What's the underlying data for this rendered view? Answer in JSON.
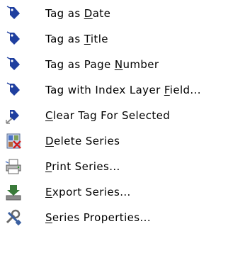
{
  "menu": {
    "items": [
      {
        "pre": "Tag as ",
        "key": "D",
        "post": "ate",
        "icon": "tag-icon"
      },
      {
        "pre": "Tag as ",
        "key": "T",
        "post": "itle",
        "icon": "tag-icon"
      },
      {
        "pre": "Tag as Page ",
        "key": "N",
        "post": "umber",
        "icon": "tag-icon"
      },
      {
        "pre": "Tag with Index Layer ",
        "key": "F",
        "post": "ield...",
        "icon": "tag-icon"
      },
      {
        "pre": "",
        "key": "C",
        "post": "lear Tag For Selected",
        "icon": "clear-tag-icon"
      },
      {
        "pre": "",
        "key": "D",
        "post": "elete Series",
        "icon": "delete-series-icon"
      },
      {
        "pre": "",
        "key": "P",
        "post": "rint Series...",
        "icon": "print-icon"
      },
      {
        "pre": "",
        "key": "E",
        "post": "xport Series...",
        "icon": "export-icon"
      },
      {
        "pre": "",
        "key": "S",
        "post": "eries Properties...",
        "icon": "properties-icon"
      }
    ]
  },
  "colors": {
    "tag_blue": "#1f3f9f",
    "arrow_gray": "#8a8a8a"
  }
}
